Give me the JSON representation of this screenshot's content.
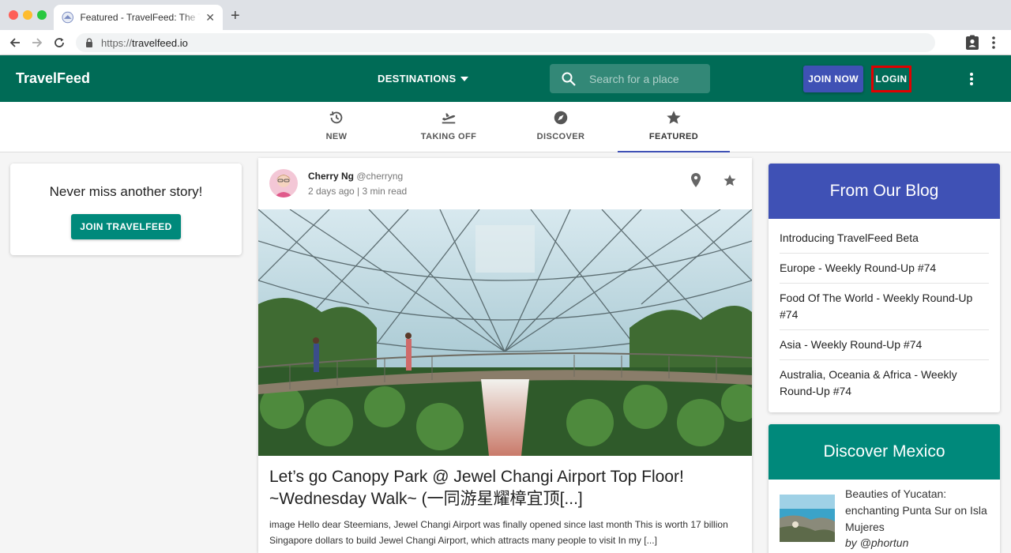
{
  "browser": {
    "tab_title": "Featured - TravelFeed: The Travel Community",
    "tab_close": "✕",
    "new_tab": "+",
    "url_protocol": "https://",
    "url_host": "travelfeed.io"
  },
  "header": {
    "brand": "TravelFeed",
    "destinations_label": "DESTINATIONS",
    "search_placeholder": "Search for a place",
    "join_label": "JOIN NOW",
    "login_label": "LOGIN",
    "bar_color": "#006b56"
  },
  "feed_tabs": [
    {
      "label": "NEW",
      "icon": "history-icon"
    },
    {
      "label": "TAKING OFF",
      "icon": "flight-takeoff-icon"
    },
    {
      "label": "DISCOVER",
      "icon": "compass-icon"
    },
    {
      "label": "FEATURED",
      "icon": "star-icon",
      "active": true
    }
  ],
  "signup_card": {
    "title": "Never miss another story!",
    "button": "JOIN TRAVELFEED"
  },
  "post": {
    "author_name": "Cherry Ng",
    "author_handle": "@cherryng",
    "meta": "2 days ago | 3 min read",
    "title": "Let’s go Canopy Park @ Jewel Changi Airport Top Floor! ~Wednesday Walk~ (一同游星耀樟宜顶[...]",
    "excerpt": "image Hello dear Steemians, Jewel Changi Airport was finally opened since last month This is worth 17 billion Singapore dollars to build Jewel Changi Airport, which attracts many people to visit In my [...]"
  },
  "blog": {
    "title": "From Our Blog",
    "items": [
      "Introducing TravelFeed Beta",
      "Europe - Weekly Round-Up #74",
      "Food Of The World - Weekly Round-Up #74",
      "Asia - Weekly Round-Up #74",
      "Australia, Oceania & Africa - Weekly Round-Up #74"
    ],
    "header_color": "#3f51b5"
  },
  "discover": {
    "title": "Discover Mexico",
    "post_title": "Beauties of Yucatan: enchanting Punta Sur on Isla Mujeres",
    "post_author": "by @phortun",
    "header_color": "#00897b"
  }
}
